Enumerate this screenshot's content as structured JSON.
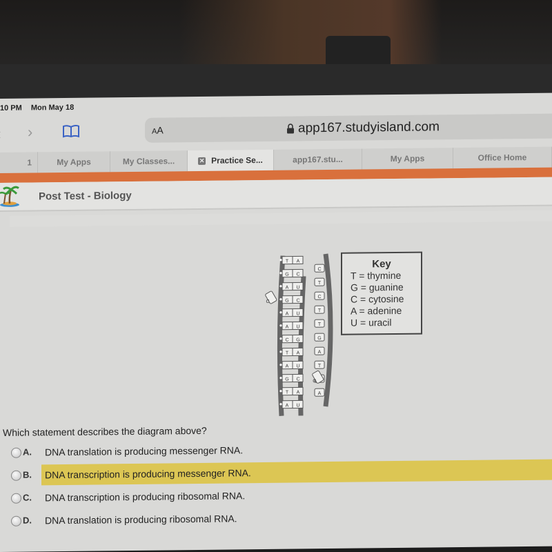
{
  "status_bar": {
    "time": "10 PM",
    "date": "Mon May 18"
  },
  "browser": {
    "text_size_label_small": "A",
    "text_size_label_large": "A",
    "url": "app167.studyisland.com",
    "tabs": [
      {
        "label": "1",
        "active": false
      },
      {
        "label": "My Apps",
        "active": false
      },
      {
        "label": "My Classes...",
        "active": false
      },
      {
        "label": "Practice Se...",
        "active": true,
        "close_icon": "✕"
      },
      {
        "label": "app167.stu...",
        "active": false
      },
      {
        "label": "My Apps",
        "active": false
      },
      {
        "label": "Office Home",
        "active": false
      }
    ],
    "accent_color": "#d9703c"
  },
  "header": {
    "title": "Post Test - Biology"
  },
  "diagram": {
    "left_strand_pairs": [
      [
        "T",
        "A"
      ],
      [
        "G",
        "C"
      ],
      [
        "A",
        "U"
      ],
      [
        "G",
        "C"
      ],
      [
        "A",
        "U"
      ],
      [
        "A",
        "U"
      ],
      [
        "C",
        "G"
      ],
      [
        "T",
        "A"
      ],
      [
        "A",
        "U"
      ],
      [
        "G",
        "C"
      ],
      [
        "T",
        "A"
      ],
      [
        "A",
        "U"
      ]
    ],
    "right_strand_bases": [
      "C",
      "T",
      "C",
      "T",
      "T",
      "G",
      "A",
      "T",
      "C",
      "A"
    ],
    "free_nucleotides": [
      "C",
      "G"
    ]
  },
  "key": {
    "title": "Key",
    "entries": [
      "T = thymine",
      "G = guanine",
      "C = cytosine",
      "A = adenine",
      "U = uracil"
    ]
  },
  "question": {
    "prompt": "Which statement describes the diagram above?",
    "answers": [
      {
        "letter": "A.",
        "text": "DNA translation is producing messenger RNA.",
        "highlighted": false
      },
      {
        "letter": "B.",
        "text": "DNA transcription is producing messenger RNA.",
        "highlighted": true
      },
      {
        "letter": "C.",
        "text": "DNA transcription is producing ribosomal RNA.",
        "highlighted": false
      },
      {
        "letter": "D.",
        "text": "DNA translation is producing ribosomal RNA.",
        "highlighted": false
      }
    ],
    "highlight_color": "#dcc654"
  }
}
